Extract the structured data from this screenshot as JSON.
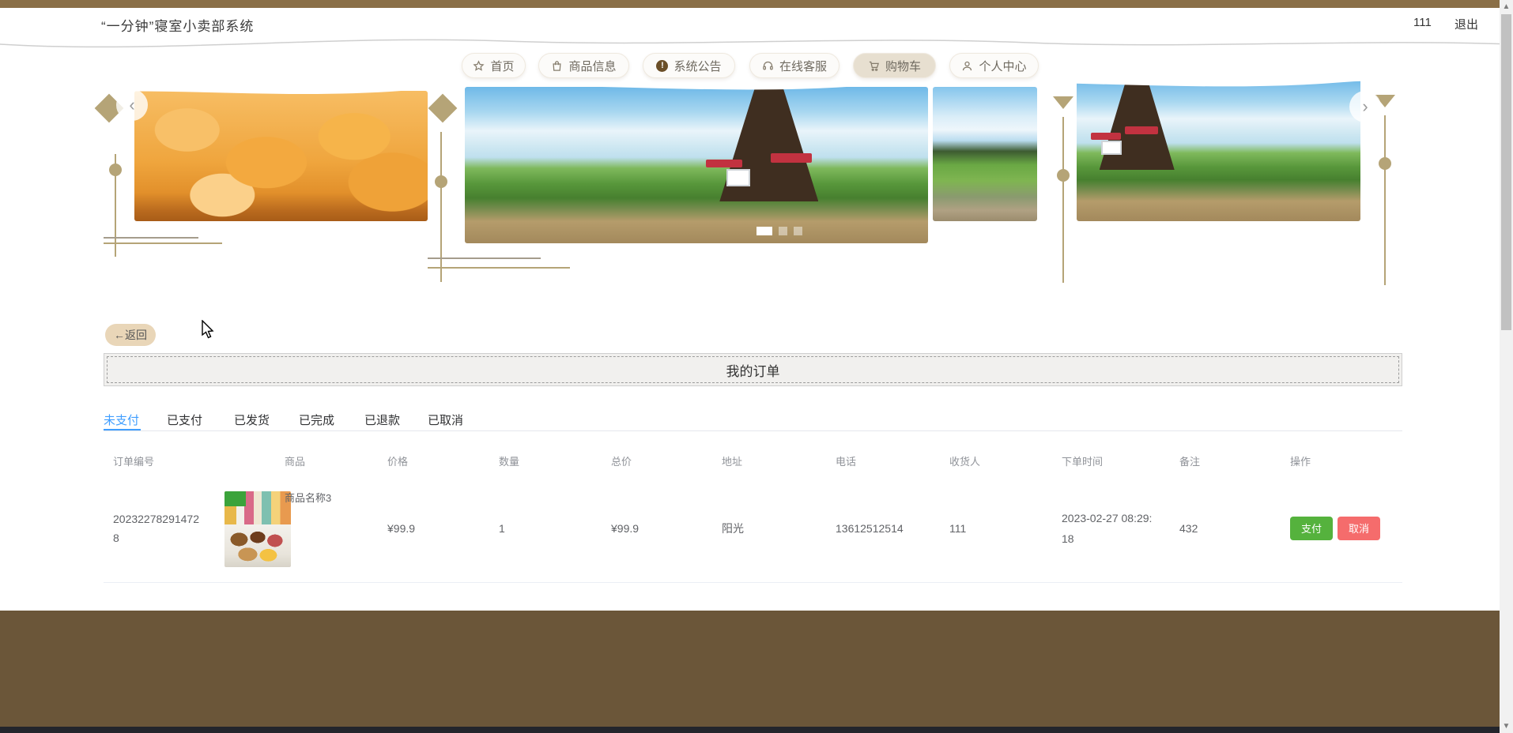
{
  "header": {
    "title": "“一分钟”寝室小卖部系统",
    "username": "111",
    "logout_label": "退出"
  },
  "nav": {
    "items": [
      {
        "icon": "star-icon",
        "label": "首页",
        "active": false
      },
      {
        "icon": "bag-icon",
        "label": "商品信息",
        "active": false
      },
      {
        "icon": "announcement-icon",
        "label": "系统公告",
        "active": false,
        "badge_char": "!"
      },
      {
        "icon": "headset-icon",
        "label": "在线客服",
        "active": false
      },
      {
        "icon": "cart-icon",
        "label": "购物车",
        "active": true
      },
      {
        "icon": "user-icon",
        "label": "个人中心",
        "active": false
      }
    ]
  },
  "carousel": {
    "prev_char": "‹",
    "next_char": "›",
    "indicator_count": 3,
    "active_indicator": 0,
    "slides": [
      "potato-chips-photo",
      "windmill-landscape-photo",
      "marsh-landscape-photo",
      "windmill-landscape-photo-small"
    ]
  },
  "back_button": {
    "arrow_char": "←",
    "label": "返回"
  },
  "orders_panel": {
    "title": "我的订单"
  },
  "tabs": {
    "items": [
      "未支付",
      "已支付",
      "已发货",
      "已完成",
      "已退款",
      "已取消"
    ],
    "active_index": 0
  },
  "table": {
    "columns": [
      "订单编号",
      "商品",
      "价格",
      "数量",
      "总价",
      "地址",
      "电话",
      "收货人",
      "下单时间",
      "备注",
      "操作"
    ],
    "rows": [
      {
        "order_no": "202322782914728",
        "product_name": "商品名称3",
        "price": "¥99.9",
        "quantity": "1",
        "total": "¥99.9",
        "address": "阳光",
        "phone": "13612512514",
        "receiver": "111",
        "time": "2023-02-27 08:29:18",
        "remark": "432",
        "pay_label": "支付",
        "cancel_label": "取消"
      }
    ]
  },
  "colors": {
    "top_bar": "#8a6f47",
    "decoration_tan": "#b5a477",
    "active_pill_bg": "#e7dfd0",
    "active_tab": "#409eff",
    "pay_button": "#55b23d",
    "cancel_button": "#f56c6c",
    "footer_brown": "#6b5639",
    "footer_dark_strip": "#23252c",
    "back_button_bg": "#e9d6b8"
  }
}
